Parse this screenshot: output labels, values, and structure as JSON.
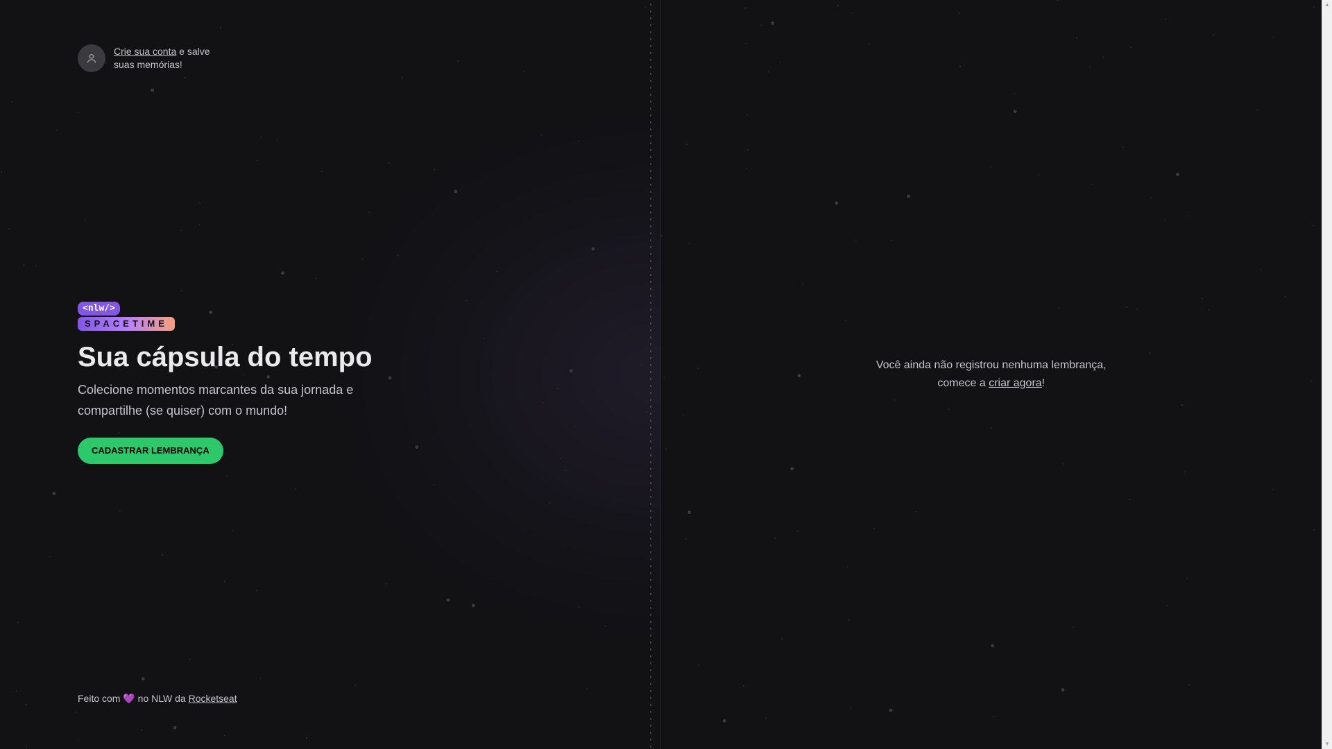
{
  "signin": {
    "link_label": "Crie sua conta",
    "rest": " e salve suas memórias!"
  },
  "logo": {
    "tag": "<nlw/>",
    "word": "SPACETIME"
  },
  "hero": {
    "title": "Sua cápsula do tempo",
    "subtitle": "Colecione momentos marcantes da sua jornada e compartilhe (se quiser) com o mundo!",
    "cta_label": "CADASTRAR LEMBRANÇA"
  },
  "footer": {
    "prefix": "Feito com ",
    "heart": "💜",
    "middle": " no NLW da ",
    "link_label": "Rocketseat"
  },
  "empty_state": {
    "line1": "Você ainda não registrou nenhuma lembrança,",
    "prefix": "comece a ",
    "link_label": "criar agora",
    "suffix": "!"
  },
  "colors": {
    "background": "#121215",
    "accent_green": "#2dc86a",
    "accent_purple": "#8257e5"
  },
  "icons": {
    "avatar": "user-icon",
    "footer": "heart-icon"
  }
}
